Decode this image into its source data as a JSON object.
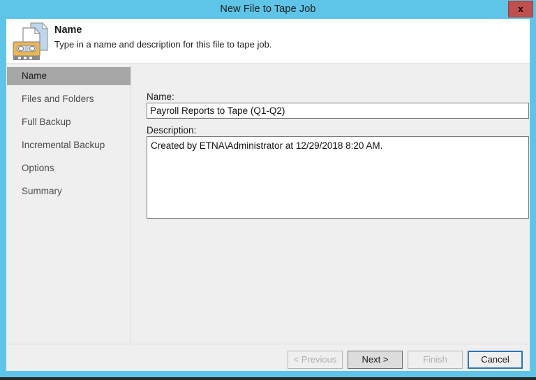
{
  "window": {
    "title": "New File to Tape Job",
    "close_label": "x",
    "accent_color": "#5ec5e8",
    "close_color": "#c0504d"
  },
  "header": {
    "icon": "tape-and-files-icon",
    "title": "Name",
    "subtitle": "Type in a name and description for this file to tape job."
  },
  "sidebar": {
    "items": [
      {
        "label": "Name",
        "selected": true
      },
      {
        "label": "Files and Folders",
        "selected": false
      },
      {
        "label": "Full Backup",
        "selected": false
      },
      {
        "label": "Incremental Backup",
        "selected": false
      },
      {
        "label": "Options",
        "selected": false
      },
      {
        "label": "Summary",
        "selected": false
      }
    ],
    "selected_bg": "#a6a6a6"
  },
  "content": {
    "name_label": "Name:",
    "name_value": "Payroll Reports to Tape (Q1-Q2)",
    "name_placeholder": "",
    "description_label": "Description:",
    "description_value": "Created by ETNA\\Administrator at 12/29/2018 8:20 AM.",
    "description_placeholder": ""
  },
  "footer": {
    "buttons": [
      {
        "label": "< Previous",
        "state": "disabled"
      },
      {
        "label": "Next >",
        "state": "default"
      },
      {
        "label": "Finish",
        "state": "disabled"
      },
      {
        "label": "Cancel",
        "state": "focus"
      }
    ]
  }
}
